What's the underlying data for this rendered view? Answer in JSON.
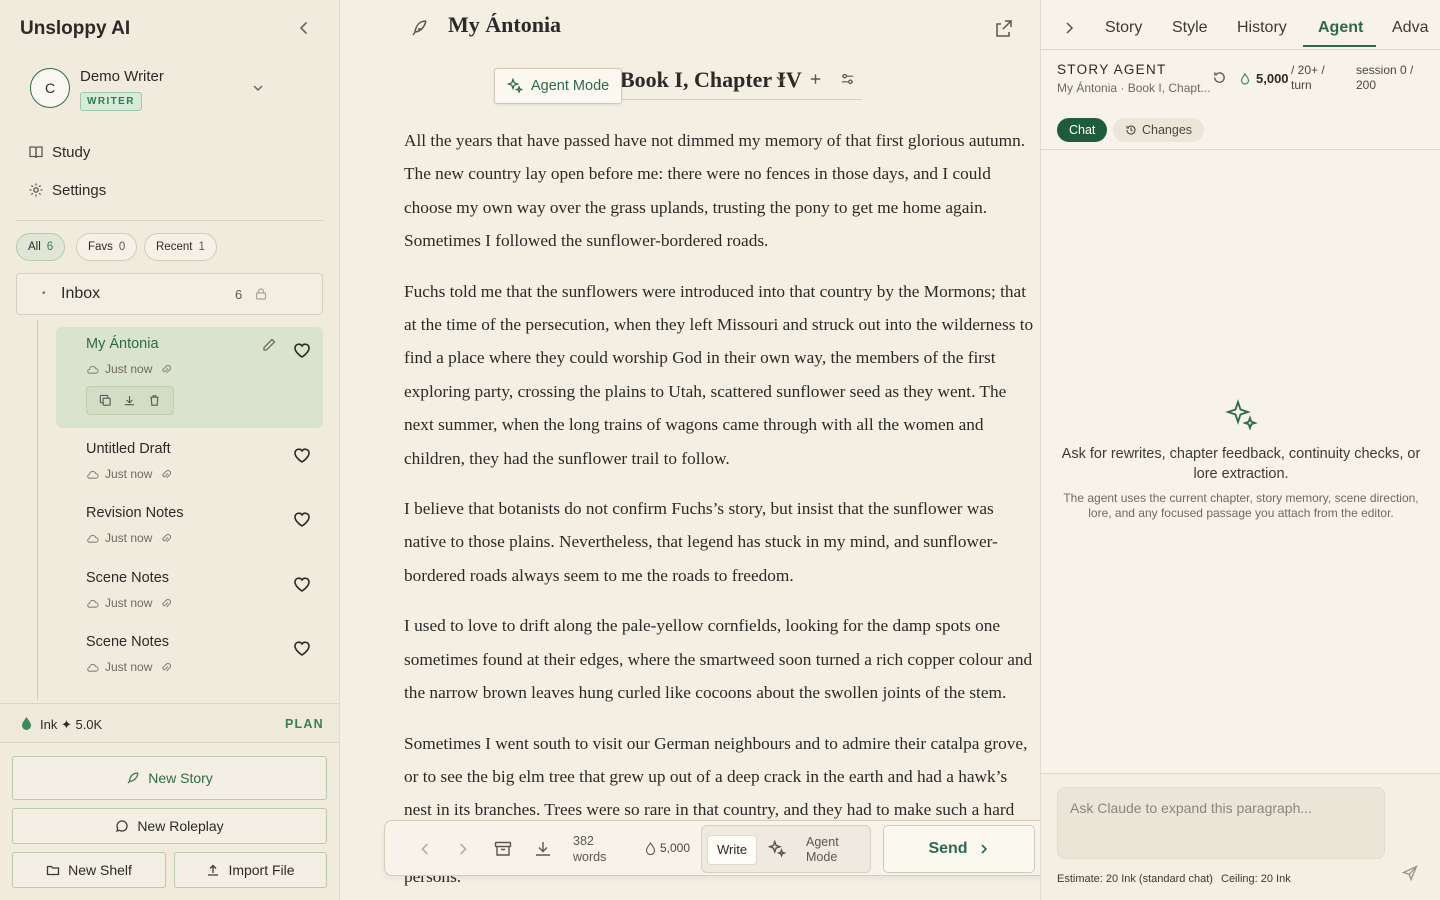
{
  "sidebar": {
    "brand": "Unsloppy AI",
    "user": {
      "initial": "C",
      "name": "Demo Writer",
      "role": "WRITER"
    },
    "nav": [
      {
        "label": "Study",
        "icon": "book-icon"
      },
      {
        "label": "Settings",
        "icon": "gear-icon"
      }
    ],
    "filters": [
      {
        "label": "All",
        "count": "6",
        "active": true
      },
      {
        "label": "Favs",
        "count": "0",
        "active": false
      },
      {
        "label": "Recent",
        "count": "1",
        "active": false
      }
    ],
    "shelf": {
      "label": "Inbox",
      "count": "6"
    },
    "stories": [
      {
        "title": "My Ántonia",
        "time": "Just now",
        "active": true
      },
      {
        "title": "Untitled Draft",
        "time": "Just now",
        "active": false
      },
      {
        "title": "Revision Notes",
        "time": "Just now",
        "active": false
      },
      {
        "title": "Scene Notes",
        "time": "Just now",
        "active": false
      },
      {
        "title": "Scene Notes",
        "time": "Just now",
        "active": false
      }
    ],
    "ink": {
      "label": "Ink ✦ 5.0K",
      "plan": "PLAN"
    },
    "buttons": {
      "new_story": "New Story",
      "new_roleplay": "New Roleplay",
      "new_shelf": "New Shelf",
      "import_file": "Import File"
    }
  },
  "editor": {
    "title": "My Ántonia",
    "chapter": "Book I, Chapter IV",
    "agent_mode_pill": "Agent Mode",
    "paragraphs": [
      "All the years that have passed have not dimmed my memory of that first glorious autumn. The new country lay open before me: there were no fences in those days, and I could choose my own way over the grass uplands, trusting the pony to get me home again. Sometimes I followed the sunflower-bordered roads.",
      "Fuchs told me that the sunflowers were introduced into that country by the Mormons; that at the time of the persecution, when they left Missouri and struck out into the wilderness to find a place where they could worship God in their own way, the members of the first exploring party, crossing the plains to Utah, scattered sunflower seed as they went. The next summer, when the long trains of wagons came through with all the women and children, they had the sunflower trail to follow.",
      "I believe that botanists do not confirm Fuchs’s story, but insist that the sunflower was native to those plains. Nevertheless, that legend has stuck in my mind, and sunflower-bordered roads always seem to me the roads to freedom.",
      "I used to love to drift along the pale-yellow cornfields, looking for the damp spots one sometimes found at their edges, where the smartweed soon turned a rich copper colour and the narrow brown leaves hung curled like cocoons about the swollen joints of the stem.",
      "Sometimes I went south to visit our German neighbours and to admire their catalpa grove, or to see the big elm tree that grew up out of a deep crack in the earth and had a hawk’s nest in its branches. Trees were so rare in that country, and they had to make such a hard fight to grow, that we used to feel anxious about them, and visit them as if they were persons."
    ],
    "toolbar": {
      "word_count": "382",
      "word_unit": "words",
      "ink": "5,000",
      "mode_write": "Write",
      "mode_agent": "Agent Mode",
      "send": "Send"
    }
  },
  "agent_panel": {
    "tabs": [
      "Story",
      "Style",
      "History",
      "Agent",
      "Adva"
    ],
    "active_tab": "Agent",
    "header": {
      "label": "STORY AGENT",
      "sub": "My Ántonia · Book I, Chapt...",
      "credits": "5,000",
      "per_turn": "/ 20+ / turn",
      "session": "session 0 / 200"
    },
    "subtabs": {
      "chat": "Chat",
      "changes": "Changes"
    },
    "empty": {
      "title": "Ask for rewrites, chapter feedback, continuity checks, or lore extraction.",
      "desc": "The agent uses the current chapter, story memory, scene direction, lore, and any focused passage you attach from the editor."
    },
    "composer": {
      "placeholder": "Ask Claude to expand this paragraph...",
      "estimate": "Estimate: 20 Ink (standard chat)",
      "ceiling": "Ceiling: 20 Ink"
    }
  },
  "colors": {
    "accent": "#2f6a48",
    "background": "#f4efe3",
    "active_story_bg": "#d9e3cd"
  }
}
